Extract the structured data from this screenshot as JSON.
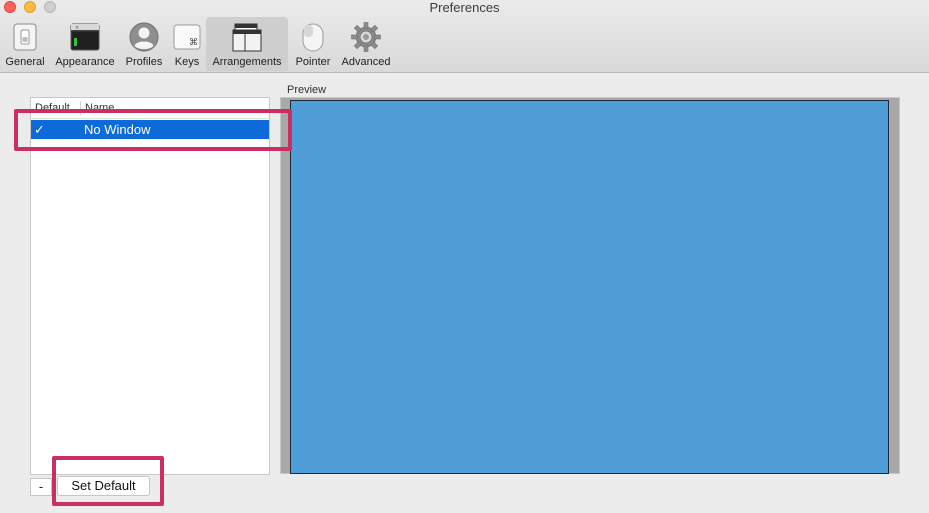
{
  "window": {
    "title": "Preferences"
  },
  "toolbar": {
    "items": [
      {
        "label": "General",
        "icon": "switch-icon"
      },
      {
        "label": "Appearance",
        "icon": "terminal-window-icon"
      },
      {
        "label": "Profiles",
        "icon": "user-silhouette-icon"
      },
      {
        "label": "Keys",
        "icon": "command-key-icon"
      },
      {
        "label": "Arrangements",
        "icon": "window-layout-icon"
      },
      {
        "label": "Pointer",
        "icon": "mouse-icon"
      },
      {
        "label": "Advanced",
        "icon": "gear-icon"
      }
    ],
    "selected": "Arrangements"
  },
  "arrangements": {
    "columns": {
      "default": "Default",
      "name": "Name"
    },
    "rows": [
      {
        "default_mark": "✓",
        "name": "No Window",
        "selected": true
      }
    ],
    "minus_label": "-",
    "set_default_label": "Set Default"
  },
  "preview": {
    "label": "Preview"
  },
  "colors": {
    "selection": "#0d6bd9",
    "preview_screen": "#4f9ed8",
    "highlight": "#c8315f"
  }
}
